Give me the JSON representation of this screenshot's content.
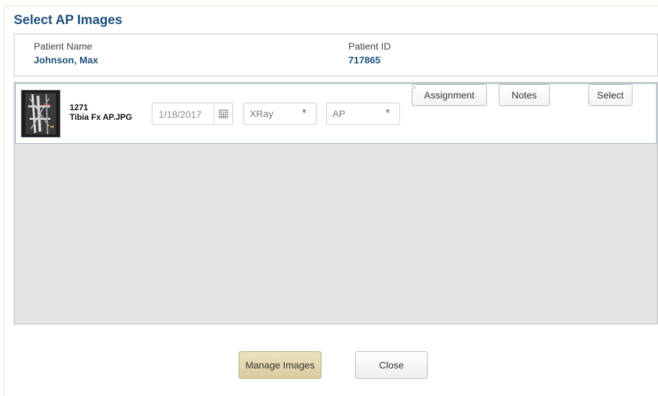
{
  "dialog": {
    "title": "Select AP Images"
  },
  "patient": {
    "name_label": "Patient Name",
    "name_value": "Johnson, Max",
    "id_label": "Patient ID",
    "id_value": "717865"
  },
  "images": [
    {
      "id": "1271",
      "filename": "Tibia Fx AP.JPG",
      "date": "1/18/2017",
      "modality": "XRay",
      "view": "AP",
      "assignment_label": "Assignment",
      "notes_label": "Notes",
      "select_label": "Select"
    }
  ],
  "icons": {
    "calendar": "calendar-icon",
    "dropdown": "chevron-down-icon",
    "caret_glyph": "▼"
  },
  "footer": {
    "manage_label": "Manage Images",
    "close_label": "Close"
  },
  "colors": {
    "title": "#1d4e7a",
    "panel_background": "#e4e4e4",
    "manage_button": "#e2d8ae"
  }
}
